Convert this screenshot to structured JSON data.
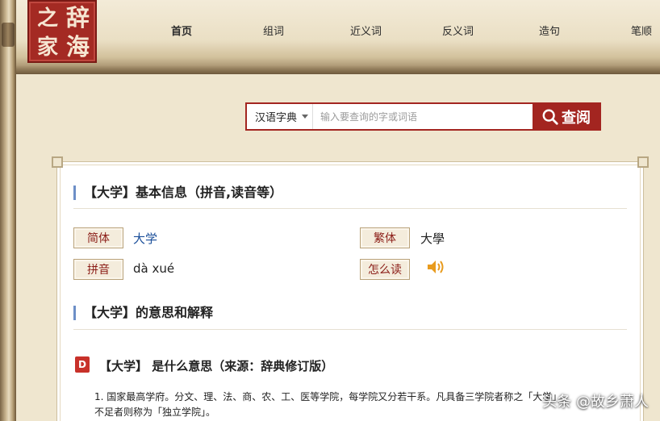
{
  "logo": {
    "chars": [
      "辞",
      "海",
      "之",
      "家"
    ]
  },
  "nav": {
    "items": [
      "首页",
      "组词",
      "近义词",
      "反义词",
      "造句",
      "笔顺"
    ]
  },
  "search": {
    "dict_select": "汉语字典",
    "placeholder": "输入要查询的字或词语",
    "button_label": "查阅",
    "accent_color": "#a32520"
  },
  "basic_info": {
    "title": "【大学】基本信息（拼音,读音等）",
    "simplified_label": "简体",
    "simplified_value": "大学",
    "traditional_label": "繁体",
    "traditional_value": "大學",
    "pinyin_label": "拼音",
    "pinyin_value": "dà xué",
    "pronounce_label": "怎么读"
  },
  "meaning": {
    "title": "【大学】的意思和解释",
    "source_icon": "D",
    "source_title": "【大学】 是什么意思（来源：辞典修订版）",
    "def_line1": "1. 国家最高学府。分文、理、法、商、农、工、医等学院，每学院又分若干系。凡具备三学院者称之「大学」",
    "def_line2": "不足者则称为「独立学院」。"
  },
  "watermark": "头条 @故乡萧人"
}
